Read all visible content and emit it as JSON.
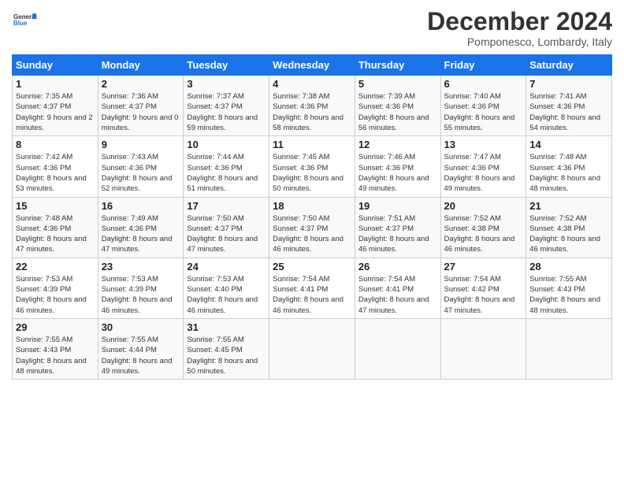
{
  "logo": {
    "line1": "General",
    "line2": "Blue"
  },
  "title": "December 2024",
  "subtitle": "Pomponesco, Lombardy, Italy",
  "days_header": [
    "Sunday",
    "Monday",
    "Tuesday",
    "Wednesday",
    "Thursday",
    "Friday",
    "Saturday"
  ],
  "weeks": [
    [
      {
        "day": "1",
        "sunrise": "7:35 AM",
        "sunset": "4:37 PM",
        "daylight": "9 hours and 2 minutes."
      },
      {
        "day": "2",
        "sunrise": "7:36 AM",
        "sunset": "4:37 PM",
        "daylight": "9 hours and 0 minutes."
      },
      {
        "day": "3",
        "sunrise": "7:37 AM",
        "sunset": "4:37 PM",
        "daylight": "8 hours and 59 minutes."
      },
      {
        "day": "4",
        "sunrise": "7:38 AM",
        "sunset": "4:36 PM",
        "daylight": "8 hours and 58 minutes."
      },
      {
        "day": "5",
        "sunrise": "7:39 AM",
        "sunset": "4:36 PM",
        "daylight": "8 hours and 56 minutes."
      },
      {
        "day": "6",
        "sunrise": "7:40 AM",
        "sunset": "4:36 PM",
        "daylight": "8 hours and 55 minutes."
      },
      {
        "day": "7",
        "sunrise": "7:41 AM",
        "sunset": "4:36 PM",
        "daylight": "8 hours and 54 minutes."
      }
    ],
    [
      {
        "day": "8",
        "sunrise": "7:42 AM",
        "sunset": "4:36 PM",
        "daylight": "8 hours and 53 minutes."
      },
      {
        "day": "9",
        "sunrise": "7:43 AM",
        "sunset": "4:36 PM",
        "daylight": "8 hours and 52 minutes."
      },
      {
        "day": "10",
        "sunrise": "7:44 AM",
        "sunset": "4:36 PM",
        "daylight": "8 hours and 51 minutes."
      },
      {
        "day": "11",
        "sunrise": "7:45 AM",
        "sunset": "4:36 PM",
        "daylight": "8 hours and 50 minutes."
      },
      {
        "day": "12",
        "sunrise": "7:46 AM",
        "sunset": "4:36 PM",
        "daylight": "8 hours and 49 minutes."
      },
      {
        "day": "13",
        "sunrise": "7:47 AM",
        "sunset": "4:36 PM",
        "daylight": "8 hours and 49 minutes."
      },
      {
        "day": "14",
        "sunrise": "7:48 AM",
        "sunset": "4:36 PM",
        "daylight": "8 hours and 48 minutes."
      }
    ],
    [
      {
        "day": "15",
        "sunrise": "7:48 AM",
        "sunset": "4:36 PM",
        "daylight": "8 hours and 47 minutes."
      },
      {
        "day": "16",
        "sunrise": "7:49 AM",
        "sunset": "4:36 PM",
        "daylight": "8 hours and 47 minutes."
      },
      {
        "day": "17",
        "sunrise": "7:50 AM",
        "sunset": "4:37 PM",
        "daylight": "8 hours and 47 minutes."
      },
      {
        "day": "18",
        "sunrise": "7:50 AM",
        "sunset": "4:37 PM",
        "daylight": "8 hours and 46 minutes."
      },
      {
        "day": "19",
        "sunrise": "7:51 AM",
        "sunset": "4:37 PM",
        "daylight": "8 hours and 46 minutes."
      },
      {
        "day": "20",
        "sunrise": "7:52 AM",
        "sunset": "4:38 PM",
        "daylight": "8 hours and 46 minutes."
      },
      {
        "day": "21",
        "sunrise": "7:52 AM",
        "sunset": "4:38 PM",
        "daylight": "8 hours and 46 minutes."
      }
    ],
    [
      {
        "day": "22",
        "sunrise": "7:53 AM",
        "sunset": "4:39 PM",
        "daylight": "8 hours and 46 minutes."
      },
      {
        "day": "23",
        "sunrise": "7:53 AM",
        "sunset": "4:39 PM",
        "daylight": "8 hours and 46 minutes."
      },
      {
        "day": "24",
        "sunrise": "7:53 AM",
        "sunset": "4:40 PM",
        "daylight": "8 hours and 46 minutes."
      },
      {
        "day": "25",
        "sunrise": "7:54 AM",
        "sunset": "4:41 PM",
        "daylight": "8 hours and 46 minutes."
      },
      {
        "day": "26",
        "sunrise": "7:54 AM",
        "sunset": "4:41 PM",
        "daylight": "8 hours and 47 minutes."
      },
      {
        "day": "27",
        "sunrise": "7:54 AM",
        "sunset": "4:42 PM",
        "daylight": "8 hours and 47 minutes."
      },
      {
        "day": "28",
        "sunrise": "7:55 AM",
        "sunset": "4:43 PM",
        "daylight": "8 hours and 48 minutes."
      }
    ],
    [
      {
        "day": "29",
        "sunrise": "7:55 AM",
        "sunset": "4:43 PM",
        "daylight": "8 hours and 48 minutes."
      },
      {
        "day": "30",
        "sunrise": "7:55 AM",
        "sunset": "4:44 PM",
        "daylight": "8 hours and 49 minutes."
      },
      {
        "day": "31",
        "sunrise": "7:55 AM",
        "sunset": "4:45 PM",
        "daylight": "8 hours and 50 minutes."
      },
      null,
      null,
      null,
      null
    ]
  ]
}
